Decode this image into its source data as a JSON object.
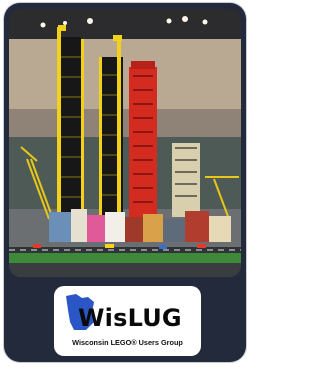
{
  "logo": {
    "wordmark": "WisLUG",
    "subtitle": "Wisconsin LEGO® Users Group",
    "icon": "wisconsin-state-outline",
    "accent_color": "#2a56c6"
  },
  "photo": {
    "subject": "lego-city-skyscrapers-display",
    "colors": {
      "tower_black": "#171717",
      "tower_yellow": "#f2d11a",
      "tower_red": "#d42b20",
      "card_bg": "#232a3b"
    }
  }
}
